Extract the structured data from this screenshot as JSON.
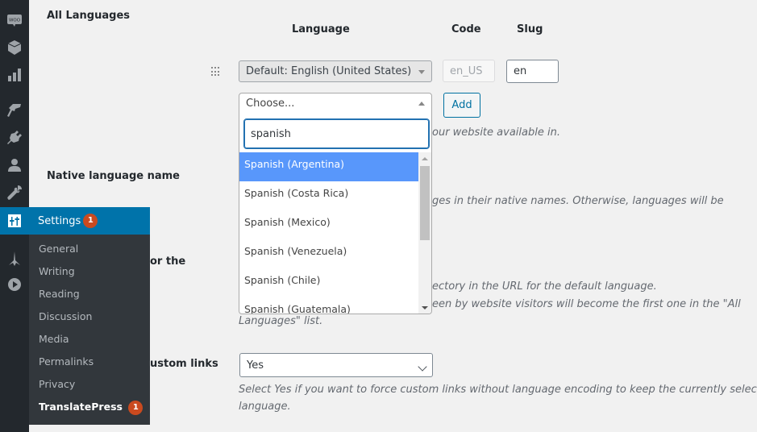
{
  "sidebar": {
    "icons": [
      {
        "name": "woocommerce-icon"
      },
      {
        "name": "products-icon"
      },
      {
        "name": "analytics-icon"
      },
      {
        "name": "appearance-icon"
      },
      {
        "name": "plugins-icon"
      },
      {
        "name": "users-icon"
      },
      {
        "name": "tools-icon"
      },
      {
        "name": "settings-icon",
        "active": true
      },
      {
        "name": "custom-plugin-icon"
      },
      {
        "name": "media-play-icon"
      }
    ],
    "flyout": {
      "title": "Settings",
      "badge": "1",
      "items": [
        {
          "label": "General"
        },
        {
          "label": "Writing"
        },
        {
          "label": "Reading"
        },
        {
          "label": "Discussion"
        },
        {
          "label": "Media"
        },
        {
          "label": "Permalinks"
        },
        {
          "label": "Privacy"
        },
        {
          "label": "TranslatePress",
          "badge": "1",
          "current": true
        }
      ]
    }
  },
  "settings": {
    "all_languages": {
      "label": "All Languages",
      "columns": {
        "language": "Language",
        "code": "Code",
        "slug": "Slug"
      },
      "default_row": {
        "language": "Default: English (United States)",
        "code": "en_US",
        "slug": "en"
      },
      "new_language": {
        "placeholder": "Choose...",
        "add_label": "Add"
      },
      "description_partial": "our website available in."
    },
    "native_name": {
      "label": "Native language name",
      "description_partial": "ges in their native names. Otherwise, languages will be"
    },
    "subdirectory": {
      "label_partial": "or the",
      "description_line1_partial": "ectory in the URL for the default language.",
      "description_line2_partial": "een by website visitors will become the first one in the \"All",
      "description_line3": "Languages\" list."
    },
    "custom_links": {
      "label_partial": "ustom links",
      "value": "Yes",
      "description_line1": "Select Yes if you want to force custom links without language encoding to keep the currently selected",
      "description_line2": "language."
    }
  },
  "dropdown": {
    "search_value": "spanish",
    "options": [
      {
        "label": "Spanish (Argentina)",
        "highlighted": true
      },
      {
        "label": "Spanish (Costa Rica)"
      },
      {
        "label": "Spanish (Mexico)"
      },
      {
        "label": "Spanish (Venezuela)"
      },
      {
        "label": "Spanish (Chile)"
      },
      {
        "label": "Spanish (Guatemala)"
      }
    ]
  },
  "colors": {
    "admin_dark": "#23282d",
    "submenu_bg": "#32373c",
    "active_blue": "#0073aa",
    "badge": "#ca4a1f",
    "highlight": "#5897fb"
  }
}
